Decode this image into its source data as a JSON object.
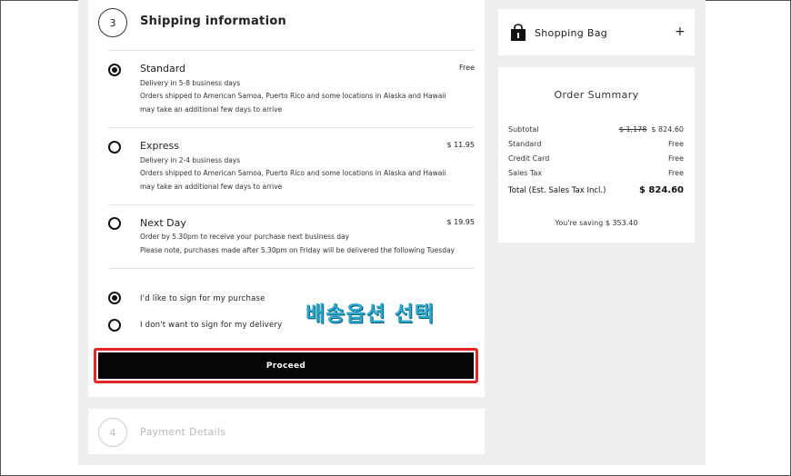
{
  "shipping": {
    "step_number": "3",
    "title": "Shipping information",
    "options": [
      {
        "name": "Standard",
        "price": "Free",
        "selected": true,
        "lines": [
          "Delivery in 5-8 business days",
          "Orders shipped to American Samoa, Puerto Rico and some locations in Alaska and Hawaii",
          "may take an additional few days to arrive"
        ]
      },
      {
        "name": "Express",
        "price": "$ 11.95",
        "selected": false,
        "lines": [
          "Delivery in 2-4 business days",
          "Orders shipped to American Samoa, Puerto Rico and some locations in Alaska and Hawaii",
          "may take an additional few days to arrive"
        ]
      },
      {
        "name": "Next Day",
        "price": "$ 19.95",
        "selected": false,
        "lines": [
          "Order by 5.30pm to receive your purchase next business day",
          "Please note, purchases made after 5.30pm on Friday will be delivered the following Tuesday"
        ]
      }
    ],
    "signature_options": [
      {
        "label": "I'd like to sign for my purchase",
        "selected": true
      },
      {
        "label": "I don't want to sign for my delivery",
        "selected": false
      }
    ],
    "proceed_label": "Proceed"
  },
  "annotation": {
    "text": "배송옵션 선택",
    "color": "#2aa6c9"
  },
  "payment": {
    "step_number": "4",
    "title": "Payment Details"
  },
  "bag": {
    "label": "Shopping Bag",
    "expand_symbol": "+",
    "icon": "shopping-bag-icon"
  },
  "summary": {
    "title": "Order Summary",
    "rows": [
      {
        "label": "Subtotal",
        "original": "$ 1,178",
        "value": "$ 824.60"
      },
      {
        "label": "Standard",
        "value": "Free"
      },
      {
        "label": "Credit Card",
        "value": "Free"
      },
      {
        "label": "Sales Tax",
        "value": "Free"
      }
    ],
    "total_label": "Total (Est. Sales Tax Incl.)",
    "total_value": "$ 824.60",
    "saving": "You're saving $ 353.40"
  },
  "colors": {
    "highlight_border": "#e32626",
    "button_bg": "#050505",
    "page_bg": "#eeeeee"
  }
}
